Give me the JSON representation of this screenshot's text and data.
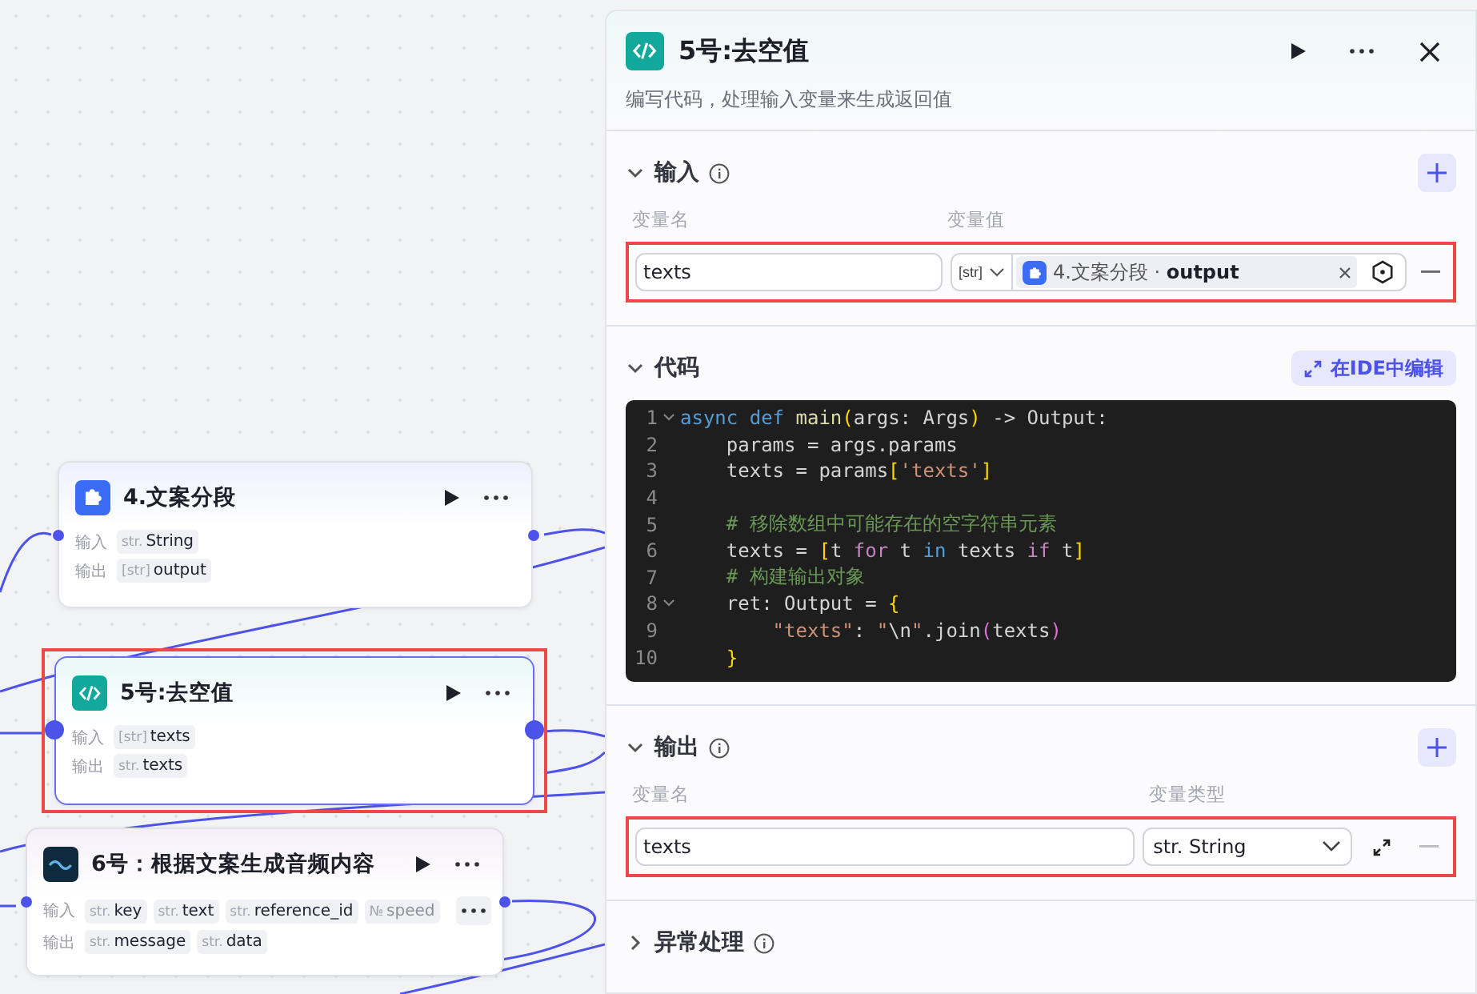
{
  "canvas": {
    "nodes": [
      {
        "kind": "text",
        "title": "4.文案分段",
        "selected": false,
        "highlighted": false,
        "rows": [
          {
            "label": "输入",
            "tags": [
              {
                "type": "str.",
                "name": "String",
                "faded": false
              }
            ]
          },
          {
            "label": "输出",
            "tags": [
              {
                "type": "[str]",
                "name": "output",
                "faded": false
              }
            ]
          }
        ],
        "more": false
      },
      {
        "kind": "code",
        "title": "5号:去空值",
        "selected": true,
        "highlighted": true,
        "rows": [
          {
            "label": "输入",
            "tags": [
              {
                "type": "[str]",
                "name": "texts",
                "faded": false
              }
            ]
          },
          {
            "label": "输出",
            "tags": [
              {
                "type": "str.",
                "name": "texts",
                "faded": false
              }
            ]
          }
        ],
        "more": false
      },
      {
        "kind": "plugin",
        "title": "6号：根据文案生成音频内容",
        "selected": false,
        "highlighted": false,
        "rows": [
          {
            "label": "输入",
            "tags": [
              {
                "type": "str.",
                "name": "key",
                "faded": false
              },
              {
                "type": "str.",
                "name": "text",
                "faded": false
              },
              {
                "type": "str.",
                "name": "reference_id",
                "faded": false
              },
              {
                "type": "№",
                "name": "speed",
                "faded": true
              }
            ]
          },
          {
            "label": "输出",
            "tags": [
              {
                "type": "str.",
                "name": "message",
                "faded": false
              },
              {
                "type": "str.",
                "name": "data",
                "faded": false
              }
            ]
          }
        ],
        "more": true
      }
    ]
  },
  "panel": {
    "title": "5号:去空值",
    "description": "编写代码，处理输入变量来生成返回值",
    "input": {
      "title": "输入",
      "expanded": true,
      "name_label": "变量名",
      "value_label": "变量值",
      "highlighted": true,
      "rows": [
        {
          "name": "texts",
          "type": "[str]",
          "ref_node": "4.文案分段",
          "ref_sep": " · ",
          "ref_var": "output"
        }
      ]
    },
    "code": {
      "title": "代码",
      "expanded": true,
      "ide_button": "在IDE中编辑",
      "lines": [
        {
          "no": "1",
          "fold": true,
          "tokens": [
            {
              "kind": "keyword",
              "text": "async def "
            },
            {
              "kind": "function",
              "text": "main"
            },
            {
              "kind": "bracket",
              "text": "("
            },
            {
              "kind": "plain",
              "text": "args: Args"
            },
            {
              "kind": "bracket",
              "text": ")"
            },
            {
              "kind": "plain",
              "text": " -> Output:"
            }
          ]
        },
        {
          "no": "2",
          "fold": false,
          "tokens": [
            {
              "kind": "plain",
              "text": "    params = args.params"
            }
          ]
        },
        {
          "no": "3",
          "fold": false,
          "tokens": [
            {
              "kind": "plain",
              "text": "    texts = params"
            },
            {
              "kind": "bracket",
              "text": "["
            },
            {
              "kind": "string",
              "text": "'texts'"
            },
            {
              "kind": "bracket",
              "text": "]"
            }
          ]
        },
        {
          "no": "4",
          "fold": false
        },
        {
          "no": "5",
          "fold": false,
          "tokens": [
            {
              "kind": "comment",
              "text": "    # 移除数组中可能存在的空字符串元素"
            }
          ]
        },
        {
          "no": "6",
          "fold": false,
          "tokens": [
            {
              "kind": "plain",
              "text": "    texts = "
            },
            {
              "kind": "bracket",
              "text": "["
            },
            {
              "kind": "plain",
              "text": "t "
            },
            {
              "kind": "control",
              "text": "for"
            },
            {
              "kind": "plain",
              "text": " t "
            },
            {
              "kind": "keyword",
              "text": "in"
            },
            {
              "kind": "plain",
              "text": " texts "
            },
            {
              "kind": "control",
              "text": "if"
            },
            {
              "kind": "plain",
              "text": " t"
            },
            {
              "kind": "bracket",
              "text": "]"
            }
          ]
        },
        {
          "no": "7",
          "fold": false,
          "tokens": [
            {
              "kind": "comment",
              "text": "    # 构建输出对象"
            }
          ]
        },
        {
          "no": "8",
          "fold": true,
          "tokens": [
            {
              "kind": "plain",
              "text": "    ret: Output = "
            },
            {
              "kind": "bracket",
              "text": "{"
            }
          ]
        },
        {
          "no": "9",
          "fold": false,
          "tokens": [
            {
              "kind": "string",
              "text": "        \"texts\""
            },
            {
              "kind": "plain",
              "text": ": "
            },
            {
              "kind": "string",
              "text": "\""
            },
            {
              "kind": "plain",
              "text": "\\n"
            },
            {
              "kind": "string",
              "text": "\""
            },
            {
              "kind": "plain",
              "text": ".join"
            },
            {
              "kind": "paren",
              "text": "("
            },
            {
              "kind": "plain",
              "text": "texts"
            },
            {
              "kind": "paren",
              "text": ")"
            }
          ]
        },
        {
          "no": "10",
          "fold": false,
          "tokens": [
            {
              "kind": "bracket",
              "text": "    }"
            }
          ]
        }
      ]
    },
    "output": {
      "title": "输出",
      "expanded": true,
      "name_label": "变量名",
      "type_label": "变量类型",
      "highlighted": true,
      "rows": [
        {
          "name": "texts",
          "type": "str. String"
        }
      ]
    },
    "error": {
      "title": "异常处理",
      "expanded": false
    }
  }
}
